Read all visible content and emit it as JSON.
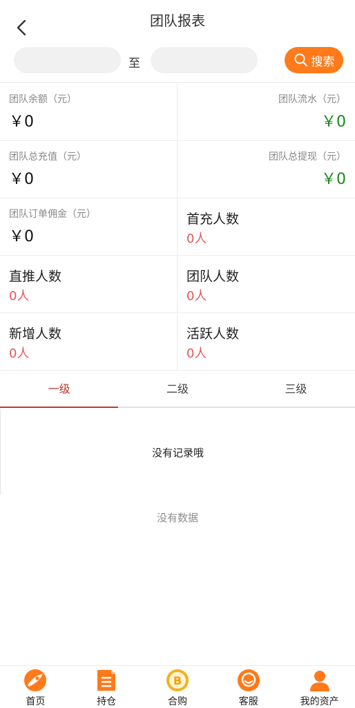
{
  "header": {
    "title": "团队报表"
  },
  "filter": {
    "start_value": "",
    "end_value": "",
    "to_label": "至",
    "search_label": "搜索"
  },
  "stats": {
    "team_balance_label": "团队余额（元）",
    "team_balance_value": "￥0",
    "team_flow_label": "团队流水（元）",
    "team_flow_value": "￥0",
    "team_recharge_label": "团队总充值（元）",
    "team_recharge_value": "￥0",
    "team_withdraw_label": "团队总提现（元）",
    "team_withdraw_value": "￥0",
    "order_commission_label": "团队订单佣金（元）",
    "order_commission_value": "￥0",
    "first_charge_label": "首充人数",
    "first_charge_value": "0人",
    "direct_label": "直推人数",
    "direct_value": "0人",
    "team_count_label": "团队人数",
    "team_count_value": "0人",
    "new_label": "新增人数",
    "new_value": "0人",
    "active_label": "活跃人数",
    "active_value": "0人"
  },
  "tabs": [
    {
      "label": "一级"
    },
    {
      "label": "二级"
    },
    {
      "label": "三级"
    }
  ],
  "records": {
    "empty_text": "没有记录哦"
  },
  "no_data_text": "没有数据",
  "nav": [
    {
      "label": "首页",
      "icon": "home-icon"
    },
    {
      "label": "持仓",
      "icon": "position-icon"
    },
    {
      "label": "合购",
      "icon": "bitcoin-icon"
    },
    {
      "label": "客服",
      "icon": "service-icon"
    },
    {
      "label": "我的资产",
      "icon": "user-icon"
    }
  ],
  "colors": {
    "accent": "#ff7a1a",
    "green": "#1b8a1b",
    "red": "#e45757",
    "tab_active": "#c0392b"
  }
}
